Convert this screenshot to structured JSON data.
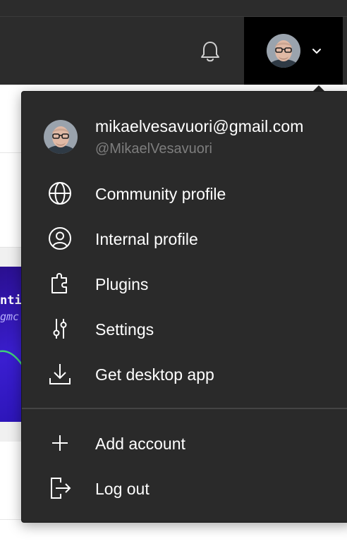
{
  "topbar": {
    "notifications_icon": "bell-icon",
    "account_menu_icon": "chevron-down-icon"
  },
  "background": {
    "thumb_line1": "nti",
    "thumb_line2": "gmc"
  },
  "account": {
    "email": "mikaelvesavuori@gmail.com",
    "handle": "@MikaelVesavuori"
  },
  "menu": {
    "items": [
      {
        "label": "Community profile",
        "icon": "globe-icon"
      },
      {
        "label": "Internal profile",
        "icon": "user-circle-icon"
      },
      {
        "label": "Plugins",
        "icon": "puzzle-icon"
      },
      {
        "label": "Settings",
        "icon": "sliders-icon"
      },
      {
        "label": "Get desktop app",
        "icon": "download-icon"
      }
    ],
    "secondary": [
      {
        "label": "Add account",
        "icon": "plus-icon"
      },
      {
        "label": "Log out",
        "icon": "logout-icon"
      }
    ]
  },
  "colors": {
    "menu_bg": "#2a2a2a",
    "topbar_bg": "#2c2c2c",
    "active_button_bg": "#000000",
    "secondary_text": "#7d7d7d"
  }
}
